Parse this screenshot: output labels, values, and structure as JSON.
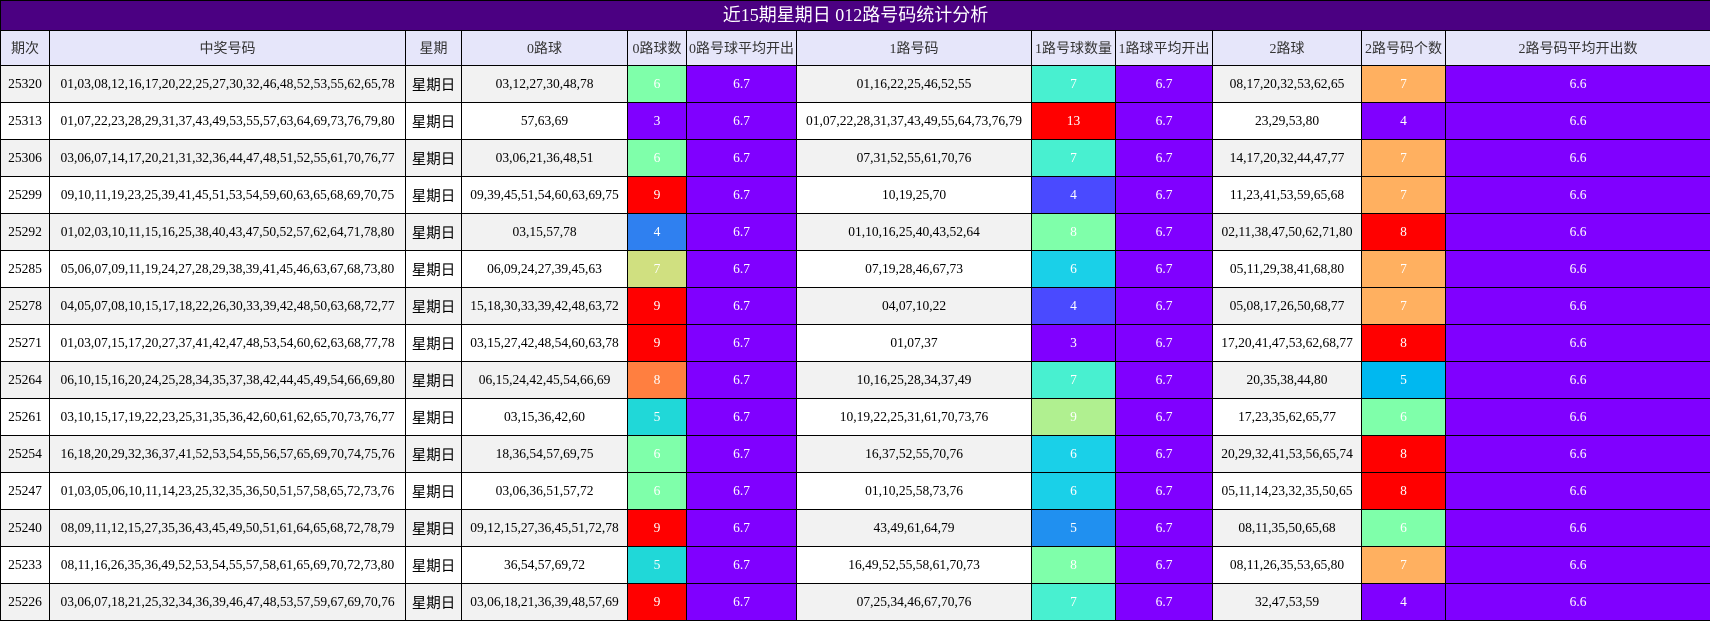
{
  "title": "近15期星期日 012路号码统计分析",
  "headers": [
    "期次",
    "中奖号码",
    "星期",
    "0路球",
    "0路球数",
    "0路号球平均开出",
    "1路号码",
    "1路号球数量",
    "1路球平均开出",
    "2路球",
    "2路号码个数",
    "2路号码平均开出数"
  ],
  "avg": {
    "r0": "6.7",
    "r1": "6.7",
    "r2": "6.6"
  },
  "rows": [
    {
      "issue": "25320",
      "nums": "01,03,08,12,16,17,20,22,25,27,30,32,46,48,52,53,55,62,65,78",
      "week": "星期日",
      "r0": "03,12,27,30,48,78",
      "c0": "6",
      "c0_color": "#7fffaa",
      "r1": "01,16,22,25,46,52,55",
      "c1": "7",
      "c1_color": "#48f0d0",
      "r2": "08,17,20,32,53,62,65",
      "c2": "7",
      "c2_color": "#ffb060"
    },
    {
      "issue": "25313",
      "nums": "01,07,22,23,28,29,31,37,43,49,53,55,57,63,64,69,73,76,79,80",
      "week": "星期日",
      "r0": "57,63,69",
      "c0": "3",
      "c0_color": "#8000ff",
      "r1": "01,07,22,28,31,37,43,49,55,64,73,76,79",
      "c1": "13",
      "c1_color": "#ff0000",
      "r2": "23,29,53,80",
      "c2": "4",
      "c2_color": "#8000ff"
    },
    {
      "issue": "25306",
      "nums": "03,06,07,14,17,20,21,31,32,36,44,47,48,51,52,55,61,70,76,77",
      "week": "星期日",
      "r0": "03,06,21,36,48,51",
      "c0": "6",
      "c0_color": "#7fffaa",
      "r1": "07,31,52,55,61,70,76",
      "c1": "7",
      "c1_color": "#48f0d0",
      "r2": "14,17,20,32,44,47,77",
      "c2": "7",
      "c2_color": "#ffb060"
    },
    {
      "issue": "25299",
      "nums": "09,10,11,19,23,25,39,41,45,51,53,54,59,60,63,65,68,69,70,75",
      "week": "星期日",
      "r0": "09,39,45,51,54,60,63,69,75",
      "c0": "9",
      "c0_color": "#ff0000",
      "r1": "10,19,25,70",
      "c1": "4",
      "c1_color": "#4a4aff",
      "r2": "11,23,41,53,59,65,68",
      "c2": "7",
      "c2_color": "#ffb060"
    },
    {
      "issue": "25292",
      "nums": "01,02,03,10,11,15,16,25,38,40,43,47,50,52,57,62,64,71,78,80",
      "week": "星期日",
      "r0": "03,15,57,78",
      "c0": "4",
      "c0_color": "#2f80f0",
      "r1": "01,10,16,25,40,43,52,64",
      "c1": "8",
      "c1_color": "#7fffaa",
      "r2": "02,11,38,47,50,62,71,80",
      "c2": "8",
      "c2_color": "#ff0000"
    },
    {
      "issue": "25285",
      "nums": "05,06,07,09,11,19,24,27,28,29,38,39,41,45,46,63,67,68,73,80",
      "week": "星期日",
      "r0": "06,09,24,27,39,45,63",
      "c0": "7",
      "c0_color": "#d0e080",
      "r1": "07,19,28,46,67,73",
      "c1": "6",
      "c1_color": "#1ad0e8",
      "r2": "05,11,29,38,41,68,80",
      "c2": "7",
      "c2_color": "#ffb060"
    },
    {
      "issue": "25278",
      "nums": "04,05,07,08,10,15,17,18,22,26,30,33,39,42,48,50,63,68,72,77",
      "week": "星期日",
      "r0": "15,18,30,33,39,42,48,63,72",
      "c0": "9",
      "c0_color": "#ff0000",
      "r1": "04,07,10,22",
      "c1": "4",
      "c1_color": "#4a4aff",
      "r2": "05,08,17,26,50,68,77",
      "c2": "7",
      "c2_color": "#ffb060"
    },
    {
      "issue": "25271",
      "nums": "01,03,07,15,17,20,27,37,41,42,47,48,53,54,60,62,63,68,77,78",
      "week": "星期日",
      "r0": "03,15,27,42,48,54,60,63,78",
      "c0": "9",
      "c0_color": "#ff0000",
      "r1": "01,07,37",
      "c1": "3",
      "c1_color": "#8000ff",
      "r2": "17,20,41,47,53,62,68,77",
      "c2": "8",
      "c2_color": "#ff0000"
    },
    {
      "issue": "25264",
      "nums": "06,10,15,16,20,24,25,28,34,35,37,38,42,44,45,49,54,66,69,80",
      "week": "星期日",
      "r0": "06,15,24,42,45,54,66,69",
      "c0": "8",
      "c0_color": "#ff7f40",
      "r1": "10,16,25,28,34,37,49",
      "c1": "7",
      "c1_color": "#48f0d0",
      "r2": "20,35,38,44,80",
      "c2": "5",
      "c2_color": "#00b8f0"
    },
    {
      "issue": "25261",
      "nums": "03,10,15,17,19,22,23,25,31,35,36,42,60,61,62,65,70,73,76,77",
      "week": "星期日",
      "r0": "03,15,36,42,60",
      "c0": "5",
      "c0_color": "#20d8d8",
      "r1": "10,19,22,25,31,61,70,73,76",
      "c1": "9",
      "c1_color": "#b0f090",
      "r2": "17,23,35,62,65,77",
      "c2": "6",
      "c2_color": "#7fffaa"
    },
    {
      "issue": "25254",
      "nums": "16,18,20,29,32,36,37,41,52,53,54,55,56,57,65,69,70,74,75,76",
      "week": "星期日",
      "r0": "18,36,54,57,69,75",
      "c0": "6",
      "c0_color": "#7fffaa",
      "r1": "16,37,52,55,70,76",
      "c1": "6",
      "c1_color": "#1ad0e8",
      "r2": "20,29,32,41,53,56,65,74",
      "c2": "8",
      "c2_color": "#ff0000"
    },
    {
      "issue": "25247",
      "nums": "01,03,05,06,10,11,14,23,25,32,35,36,50,51,57,58,65,72,73,76",
      "week": "星期日",
      "r0": "03,06,36,51,57,72",
      "c0": "6",
      "c0_color": "#7fffaa",
      "r1": "01,10,25,58,73,76",
      "c1": "6",
      "c1_color": "#1ad0e8",
      "r2": "05,11,14,23,32,35,50,65",
      "c2": "8",
      "c2_color": "#ff0000"
    },
    {
      "issue": "25240",
      "nums": "08,09,11,12,15,27,35,36,43,45,49,50,51,61,64,65,68,72,78,79",
      "week": "星期日",
      "r0": "09,12,15,27,36,45,51,72,78",
      "c0": "9",
      "c0_color": "#ff0000",
      "r1": "43,49,61,64,79",
      "c1": "5",
      "c1_color": "#2090f0",
      "r2": "08,11,35,50,65,68",
      "c2": "6",
      "c2_color": "#7fffaa"
    },
    {
      "issue": "25233",
      "nums": "08,11,16,26,35,36,49,52,53,54,55,57,58,61,65,69,70,72,73,80",
      "week": "星期日",
      "r0": "36,54,57,69,72",
      "c0": "5",
      "c0_color": "#20d8d8",
      "r1": "16,49,52,55,58,61,70,73",
      "c1": "8",
      "c1_color": "#7fffaa",
      "r2": "08,11,26,35,53,65,80",
      "c2": "7",
      "c2_color": "#ffb060"
    },
    {
      "issue": "25226",
      "nums": "03,06,07,18,21,25,32,34,36,39,46,47,48,53,57,59,67,69,70,76",
      "week": "星期日",
      "r0": "03,06,18,21,36,39,48,57,69",
      "c0": "9",
      "c0_color": "#ff0000",
      "r1": "07,25,34,46,67,70,76",
      "c1": "7",
      "c1_color": "#48f0d0",
      "r2": "32,47,53,59",
      "c2": "4",
      "c2_color": "#8000ff"
    }
  ]
}
